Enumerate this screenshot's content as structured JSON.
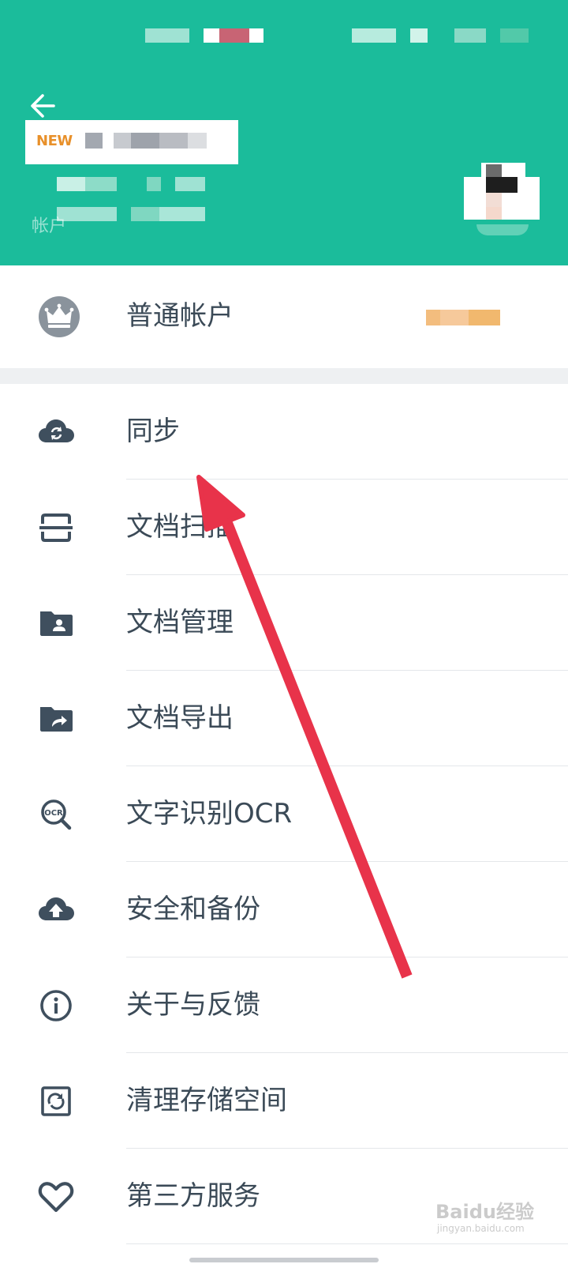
{
  "header": {
    "badge_new": "NEW",
    "account_label": "帐户",
    "bg_color": "#1bbc9b"
  },
  "account": {
    "label": "普通帐户",
    "icon": "crown-icon"
  },
  "menu": {
    "items": [
      {
        "label": "同步",
        "icon": "cloud-sync-icon"
      },
      {
        "label": "文档扫描",
        "icon": "scan-icon"
      },
      {
        "label": "文档管理",
        "icon": "folder-user-icon"
      },
      {
        "label": "文档导出",
        "icon": "folder-share-icon"
      },
      {
        "label": "文字识别OCR",
        "icon": "ocr-icon"
      },
      {
        "label": "安全和备份",
        "icon": "cloud-upload-icon"
      },
      {
        "label": "关于与反馈",
        "icon": "info-icon"
      },
      {
        "label": "清理存储空间",
        "icon": "clean-storage-icon"
      },
      {
        "label": "第三方服务",
        "icon": "heart-icon"
      }
    ]
  },
  "annotation": {
    "color": "#e8334a"
  },
  "watermark": {
    "text": "Baidu经验",
    "sub": "jingyan.baidu.com"
  }
}
